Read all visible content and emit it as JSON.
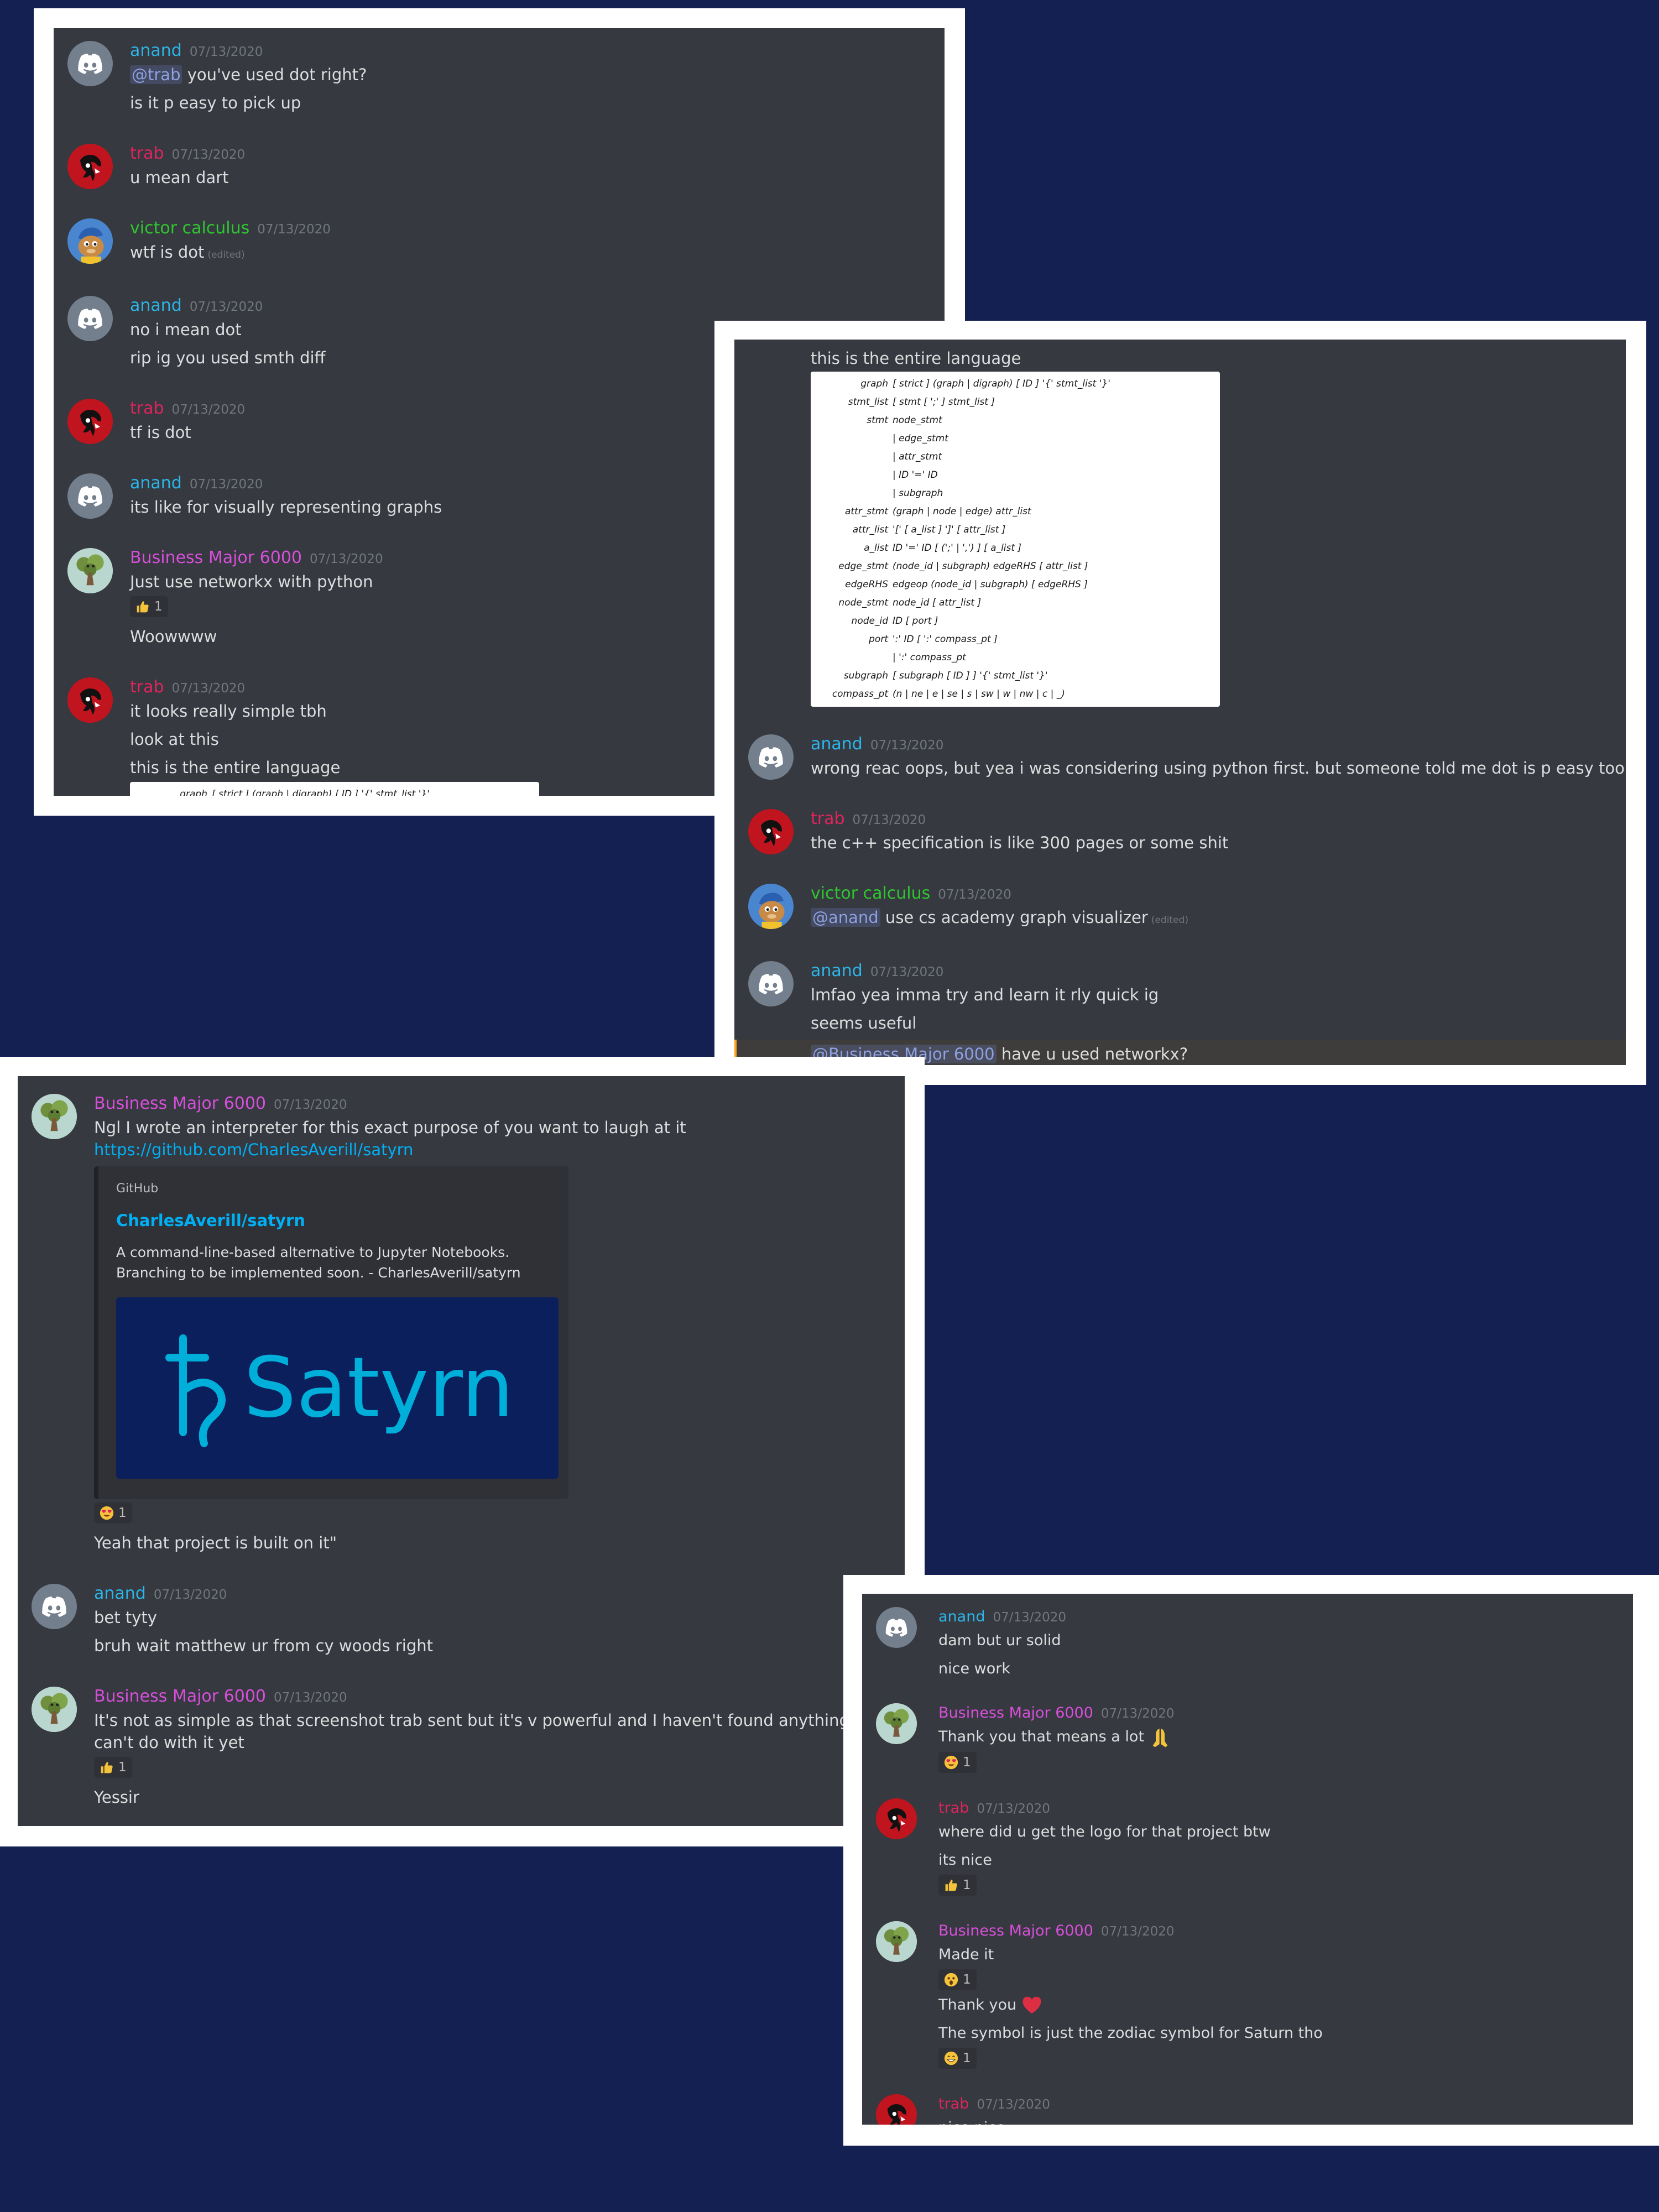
{
  "users": {
    "anand": "anand",
    "trab": "trab",
    "victor": "victor calculus",
    "bm": "Business Major 6000"
  },
  "date": "07/13/2020",
  "edited_label": "(edited)",
  "panel1": {
    "m1": {
      "mention": "@trab",
      "line1_rest": " you've used dot right?",
      "line2": "is it p easy to pick up"
    },
    "m2": {
      "line1": "u mean dart"
    },
    "m3": {
      "line1": "wtf is dot"
    },
    "m4": {
      "line1": "no i mean dot",
      "line2": "rip ig you used smth diff"
    },
    "m5": {
      "line1": "tf is dot"
    },
    "m6": {
      "line1": "its like for visually representing graphs"
    },
    "m7": {
      "line1": "Just use networkx with python",
      "reaction_count": "1",
      "line2": "Woowwww"
    },
    "m8": {
      "line1": "it looks really simple tbh",
      "line2": "look at this",
      "line3": "this is the entire language"
    }
  },
  "grammar": {
    "rows": [
      {
        "label": "graph",
        "rule": "[ strict ] (graph | digraph) [ ID ] '{' stmt_list '}'"
      },
      {
        "label": "stmt_list",
        "rule": "[ stmt [ ';' ] stmt_list ]"
      },
      {
        "label": "stmt",
        "rule": "node_stmt"
      },
      {
        "label": "",
        "rule": "| edge_stmt"
      },
      {
        "label": "",
        "rule": "| attr_stmt"
      },
      {
        "label": "",
        "rule": "| ID '=' ID"
      },
      {
        "label": "",
        "rule": "| subgraph"
      },
      {
        "label": "attr_stmt",
        "rule": "(graph | node | edge) attr_list"
      },
      {
        "label": "attr_list",
        "rule": "'[' [ a_list ] ']' [ attr_list ]"
      },
      {
        "label": "a_list",
        "rule": "ID '=' ID [ (';' | ',') ] [ a_list ]"
      },
      {
        "label": "edge_stmt",
        "rule": "(node_id | subgraph) edgeRHS [ attr_list ]"
      },
      {
        "label": "edgeRHS",
        "rule": "edgeop (node_id | subgraph) [ edgeRHS ]"
      },
      {
        "label": "node_stmt",
        "rule": "node_id [ attr_list ]"
      },
      {
        "label": "node_id",
        "rule": "ID [ port ]"
      },
      {
        "label": "port",
        "rule": "':' ID [ ':' compass_pt ]"
      },
      {
        "label": "",
        "rule": "| ':' compass_pt"
      },
      {
        "label": "subgraph",
        "rule": "[ subgraph [ ID ] ] '{' stmt_list '}'"
      },
      {
        "label": "compass_pt",
        "rule": "(n | ne | e | se | s | sw | w | nw | c | _)"
      }
    ]
  },
  "panel2": {
    "top_line": "this is the entire language",
    "m1": {
      "line1": "wrong reac oops, but yea i was considering using python first. but someone told me dot is p easy too"
    },
    "m2": {
      "line1": "the c++ specification is like 300 pages or some shit"
    },
    "m3": {
      "mention": "@anand",
      "line1_rest": " use cs academy graph visualizer"
    },
    "m4": {
      "line1": "lmfao yea imma try and learn it rly quick ig",
      "line2": "seems useful"
    },
    "m5": {
      "mention": "@Business Major 6000",
      "line1_rest": " have u used networkx?"
    }
  },
  "panel3": {
    "m1": {
      "line1": "Ngl I wrote an interpreter for this exact purpose of you want to laugh at it",
      "link": "https://github.com/CharlesAverill/satyrn",
      "embed": {
        "provider": "GitHub",
        "title": "CharlesAverill/satyrn",
        "description": "A command-line-based alternative to Jupyter Notebooks. Branching to be implemented soon. - CharlesAverill/satyrn",
        "image_text": "Satyrn"
      },
      "reaction_count": "1",
      "line2": "Yeah that project is built on it\""
    },
    "m2": {
      "line1": "bet tyty",
      "line2": "bruh wait matthew ur from cy woods right"
    },
    "m3": {
      "line1": "It's not as simple as that screenshot trab sent but it's v powerful and I haven't found anything you can't do with it yet",
      "reaction_count": "1",
      "line2": "Yessir"
    }
  },
  "panel4": {
    "m1": {
      "line1": "dam but ur solid",
      "line2": "nice work"
    },
    "m2": {
      "line1": "Thank you that means a lot",
      "reaction_count": "1"
    },
    "m3": {
      "line1": "where did u get the logo for that project btw",
      "line2": "its nice",
      "reaction_count": "1"
    },
    "m4": {
      "line1": "Made it",
      "reaction1_count": "1",
      "line2": "Thank you",
      "line3": "The symbol is just the zodiac symbol for Saturn tho",
      "reaction2_count": "1"
    },
    "m5": {
      "line1": "nice nice"
    }
  },
  "icons": [
    "discord-logo-icon",
    "thumbs-up-icon",
    "heart-eyes-icon",
    "praying-hands-icon",
    "astonished-icon",
    "red-heart-icon",
    "grin-icon",
    "saturn-symbol-icon"
  ],
  "colors": {
    "background": "#141f52",
    "panel": "#36393f",
    "anand": "#2cb5e8",
    "trab": "#e0245e",
    "victor": "#2fc72f",
    "business_major": "#d84fdb",
    "link": "#00b0f4"
  }
}
